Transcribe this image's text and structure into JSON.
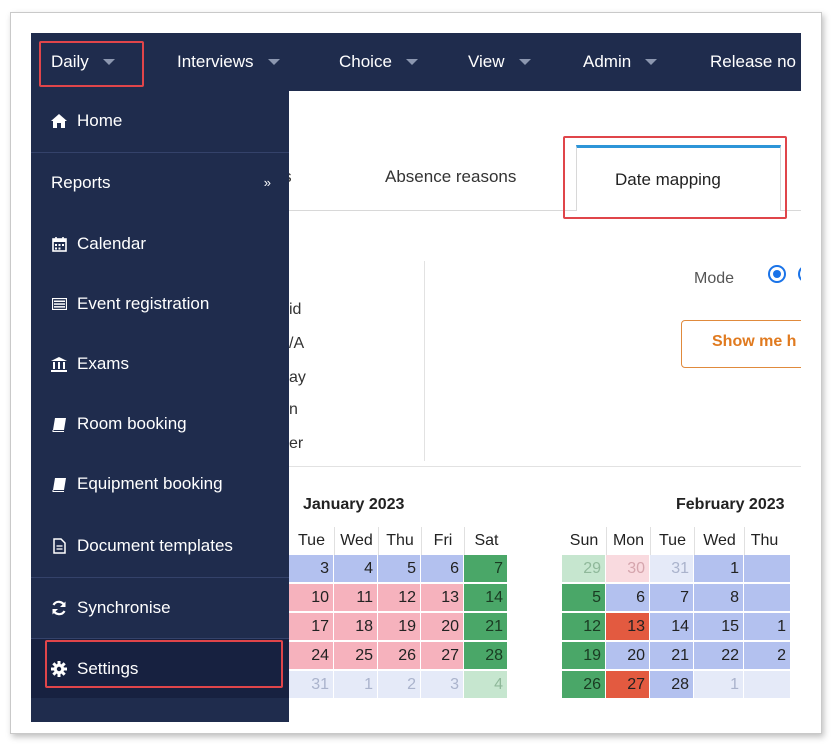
{
  "nav": {
    "daily": "Daily",
    "interviews": "Interviews",
    "choice": "Choice",
    "view": "View",
    "admin": "Admin",
    "release": "Release no"
  },
  "menu": {
    "home": "Home",
    "reports": "Reports",
    "reports_chevron": "»",
    "calendar": "Calendar",
    "event_registration": "Event registration",
    "exams": "Exams",
    "room_booking": "Room booking",
    "equipment_booking": "Equipment booking",
    "document_templates": "Document templates",
    "synchronise": "Synchronise",
    "settings": "Settings"
  },
  "tabs": {
    "events_fragment": "nts",
    "absence_reasons": "Absence reasons",
    "date_mapping": "Date mapping"
  },
  "legend_fragments": [
    "id",
    "/A",
    "ay",
    "n",
    "er"
  ],
  "mode": {
    "label": "Mode"
  },
  "show_me_button": "Show me h",
  "calendar": {
    "jan_title": "January 2023",
    "feb_title": "February 2023",
    "jan_days": [
      "Tue",
      "Wed",
      "Thu",
      "Fri",
      "Sat"
    ],
    "feb_days": [
      "Sun",
      "Mon",
      "Tue",
      "Wed",
      "Thu"
    ]
  },
  "colors": {
    "nav_bg": "#1f2c4d",
    "accent_blue": "#2d95d8",
    "highlight_red": "#e0454a",
    "orange": "#e07a1f",
    "weekday_blue": "#b3c1ef",
    "holiday_pink": "#f6b2bd",
    "weekend_green": "#4aa768",
    "red_day": "#e35a40"
  }
}
